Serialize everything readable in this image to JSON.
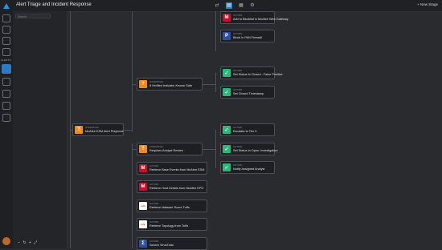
{
  "header": {
    "title": "Alert Triage and Incident Response",
    "new_stage_label": "+ New Stage"
  },
  "sidebar": {
    "section_label": "ALERTS"
  },
  "panel": {
    "search_placeholder": "Search"
  },
  "nodes": [
    {
      "kind": "Action",
      "label": "Add to Blocklist in McAfee Web Gateway",
      "icon": "mcafee"
    },
    {
      "kind": "Action",
      "label": "Block in PAN Firewall",
      "icon": "pan"
    },
    {
      "kind": "Condition",
      "label": "If Verified Indicator Known Safe",
      "icon": "condition"
    },
    {
      "kind": "Action",
      "label": "Set Status to Closed - False Positive",
      "icon": "check"
    },
    {
      "kind": "Action",
      "label": "Set Closed Timestamp",
      "icon": "check"
    },
    {
      "kind": "Condition",
      "label": "Requires Analyst Review",
      "icon": "condition"
    },
    {
      "kind": "Action",
      "label": "Escalate to Tier 3",
      "icon": "check"
    },
    {
      "kind": "Action",
      "label": "Set Status to Open: Investigation",
      "icon": "check"
    },
    {
      "kind": "Action",
      "label": "Notify Assigned Analyst",
      "icon": "check"
    },
    {
      "kind": "Condition",
      "label": "McAfee ESM Alert Playbook",
      "icon": "condition"
    },
    {
      "kind": "Action",
      "label": "Retrieve Base Events from McAfee ESM",
      "icon": "mcafee"
    },
    {
      "kind": "Action",
      "label": "Retrieve Host Details from McAfee EPO",
      "icon": "mcafee"
    },
    {
      "kind": "Action",
      "label": "Retrieve Malware Score Tuffs",
      "icon": "tuffs"
    },
    {
      "kind": "Action",
      "label": "Retrieve Topology from Tuffs",
      "icon": "tuffs"
    },
    {
      "kind": "Action",
      "label": "Search VirusTotal",
      "icon": "virustotal"
    }
  ],
  "toolbar": {
    "zoom_out": "−",
    "zoom_in": "+",
    "fit": "⤢"
  }
}
